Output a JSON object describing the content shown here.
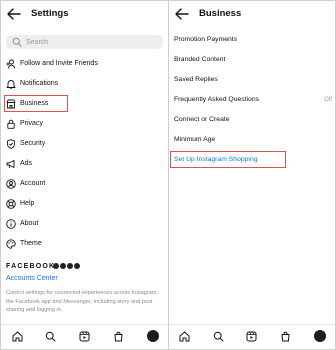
{
  "left": {
    "title": "Settings",
    "search_placeholder": "Search",
    "menu": [
      {
        "label": "Follow and Invite Friends",
        "icon": "add-person-icon"
      },
      {
        "label": "Notifications",
        "icon": "bell-icon"
      },
      {
        "label": "Business",
        "icon": "storefront-icon"
      },
      {
        "label": "Privacy",
        "icon": "lock-icon"
      },
      {
        "label": "Security",
        "icon": "shield-icon"
      },
      {
        "label": "Ads",
        "icon": "megaphone-icon"
      },
      {
        "label": "Account",
        "icon": "person-circle-icon"
      },
      {
        "label": "Help",
        "icon": "lifebuoy-icon"
      },
      {
        "label": "About",
        "icon": "info-icon"
      },
      {
        "label": "Theme",
        "icon": "palette-icon"
      }
    ],
    "facebook_label": "FACEBOOK",
    "accounts_center": "Accounts Center",
    "accounts_description": "Control settings for connected experiences across Instagram, the Facebook app and Messenger, including story and post sharing and logging in."
  },
  "right": {
    "title": "Business",
    "items": [
      {
        "label": "Promotion Payments"
      },
      {
        "label": "Branded Content"
      },
      {
        "label": "Saved Replies"
      },
      {
        "label": "Frequently Asked Questions",
        "value": "Off"
      },
      {
        "label": "Connect or Create"
      },
      {
        "label": "Minimum Age"
      },
      {
        "label": "Set Up Instagram Shopping"
      }
    ]
  },
  "nav_icons": [
    "home-icon",
    "search-icon",
    "reels-icon",
    "shop-icon",
    "profile-avatar"
  ],
  "colors": {
    "link": "#1a73d9",
    "highlight_border": "#e05252",
    "search_bg": "#eeeeee"
  }
}
